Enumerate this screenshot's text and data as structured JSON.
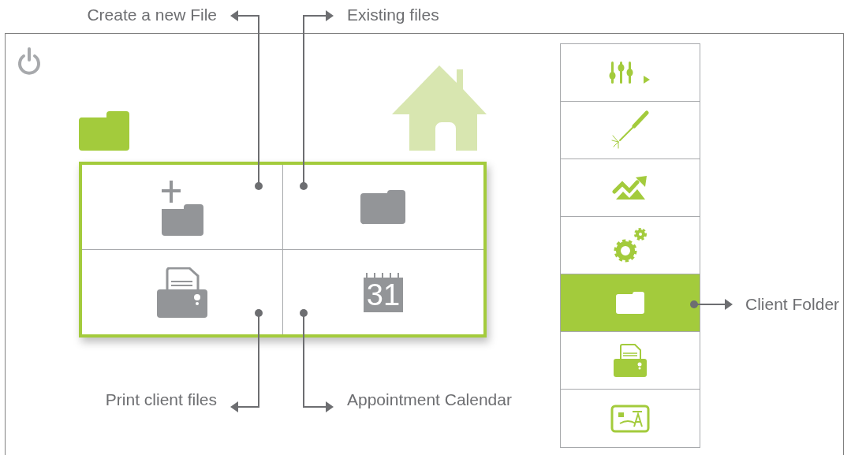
{
  "callouts": [
    {
      "label": "Create a new File"
    },
    {
      "label": "Existing files"
    },
    {
      "label": "Print client files"
    },
    {
      "label": "Appointment Calendar"
    },
    {
      "label": "Client Folder"
    }
  ],
  "tiles": [
    {
      "kind": "add-folder"
    },
    {
      "kind": "folder"
    },
    {
      "kind": "printer"
    },
    {
      "kind": "calendar",
      "date": "31"
    }
  ],
  "sidebar": {
    "items": [
      {
        "kind": "sliders",
        "selected": false
      },
      {
        "kind": "welder",
        "selected": false
      },
      {
        "kind": "chart",
        "selected": false
      },
      {
        "kind": "gears",
        "selected": false
      },
      {
        "kind": "folder",
        "selected": true
      },
      {
        "kind": "printer",
        "selected": false
      },
      {
        "kind": "card",
        "selected": false
      }
    ]
  }
}
